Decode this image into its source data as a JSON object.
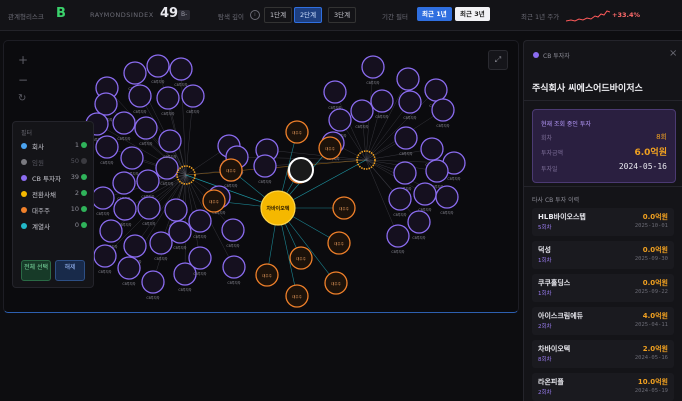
{
  "header": {
    "risk_label": "관계형리스크",
    "risk_grade": "B",
    "index_label": "RAYMONDSINDEX",
    "index_value": "49",
    "index_grade": "B-",
    "depth_label": "탐색 깊이",
    "depth_options": [
      "1단계",
      "2단계",
      "3단계"
    ],
    "period_label": "기간 필터",
    "period_options": [
      "최근 1년",
      "최근 3년"
    ],
    "price_label": "최근 1년 주가",
    "price_change": "+33.4%"
  },
  "colors": {
    "company": "#f5b800",
    "cb_investor": "#8b6cf0",
    "issuer": "#f0802a",
    "major_holder": "#f0802a",
    "gaeinsa": "#22b8c8",
    "positive": "#ff6b6b",
    "accent_blue": "#2f6fe0"
  },
  "graph_controls": {
    "zoom_in": "+",
    "zoom_out": "−",
    "reset": "↻",
    "expand": "⤢"
  },
  "filters": {
    "title": "필터",
    "rows": [
      {
        "name": "회사",
        "count": "1",
        "color": "#4aa3f0"
      },
      {
        "name": "임원",
        "count": "50",
        "color": "#7a7a80"
      },
      {
        "name": "CB 투자자",
        "count": "39",
        "color": "#8b6cf0"
      },
      {
        "name": "전환사채",
        "count": "2",
        "color": "#f5b800"
      },
      {
        "name": "대주주",
        "count": "10",
        "color": "#f0802a"
      },
      {
        "name": "계열사",
        "count": "0",
        "color": "#22b8c8"
      }
    ],
    "select_all": "전체 선택",
    "deselect": "해제"
  },
  "graph": {
    "center_label": "차바이오텍",
    "selected_label": "CB투자자",
    "node_labels": [
      "CB투자자",
      "대주주",
      "서브명",
      "차바이오텍",
      "김혜숙",
      "최천희",
      "지바이"
    ]
  },
  "detail": {
    "type_label": "CB 투자자",
    "close_icon": "×",
    "name": "주식회사 씨에스어드바이저스",
    "card_title": "현재 조회 중인 투자",
    "card_rows": [
      {
        "label": "회차",
        "value": "8회"
      },
      {
        "label": "투자금액",
        "value": "6.0억원"
      },
      {
        "label": "투자일",
        "value": "2024-05-16"
      }
    ],
    "history_title": "타사 CB 투자 이력",
    "history": [
      {
        "company": "HLB바이오스텝",
        "round": "5회차",
        "amount": "0.0억원",
        "date": "2025-10-01"
      },
      {
        "company": "덕성",
        "round": "1회차",
        "amount": "0.0억원",
        "date": "2025-09-30"
      },
      {
        "company": "쿠쿠홀딩스",
        "round": "1회차",
        "amount": "0.0억원",
        "date": "2025-09-22"
      },
      {
        "company": "아이스크림에듀",
        "round": "2회차",
        "amount": "4.0억원",
        "date": "2025-04-11"
      },
      {
        "company": "차바이오텍",
        "round": "8회차",
        "amount": "2.0억원",
        "date": "2024-05-16"
      },
      {
        "company": "라온피플",
        "round": "2회차",
        "amount": "10.0억원",
        "date": "2024-05-19"
      }
    ]
  }
}
